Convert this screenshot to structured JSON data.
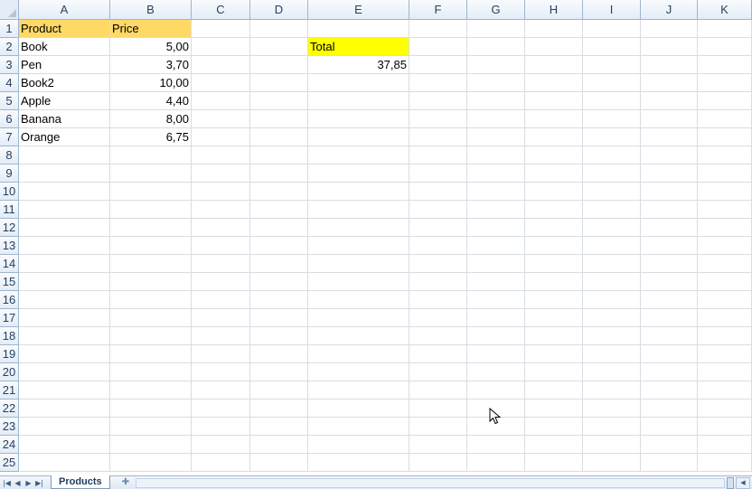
{
  "spreadsheet": {
    "columns": [
      "A",
      "B",
      "C",
      "D",
      "E",
      "F",
      "G",
      "H",
      "I",
      "J",
      "K"
    ],
    "row_numbers": [
      "1",
      "2",
      "3",
      "4",
      "5",
      "6",
      "7",
      "8",
      "9",
      "10",
      "11",
      "12",
      "13",
      "14",
      "15",
      "16",
      "17",
      "18",
      "19",
      "20",
      "21",
      "22",
      "23",
      "24",
      "25"
    ],
    "header_fill": "#ffd966",
    "total_fill": "#ffff00",
    "cells": {
      "A1": "Product",
      "B1": "Price",
      "A2": "Book",
      "B2": "5,00",
      "A3": "Pen",
      "B3": "3,70",
      "A4": "Book2",
      "B4": "10,00",
      "A5": "Apple",
      "B5": "4,40",
      "A6": "Banana",
      "B6": "8,00",
      "A7": "Orange",
      "B7": "6,75",
      "E2": "Total",
      "E3": "37,85"
    }
  },
  "sheet_tabs": [
    {
      "label": "Products",
      "active": true
    }
  ],
  "sheet_nav": {
    "first_icon": "first-sheet-icon",
    "prev_icon": "prev-sheet-icon",
    "next_icon": "next-sheet-icon",
    "last_icon": "last-sheet-icon",
    "insert_icon": "insert-sheet-icon"
  }
}
